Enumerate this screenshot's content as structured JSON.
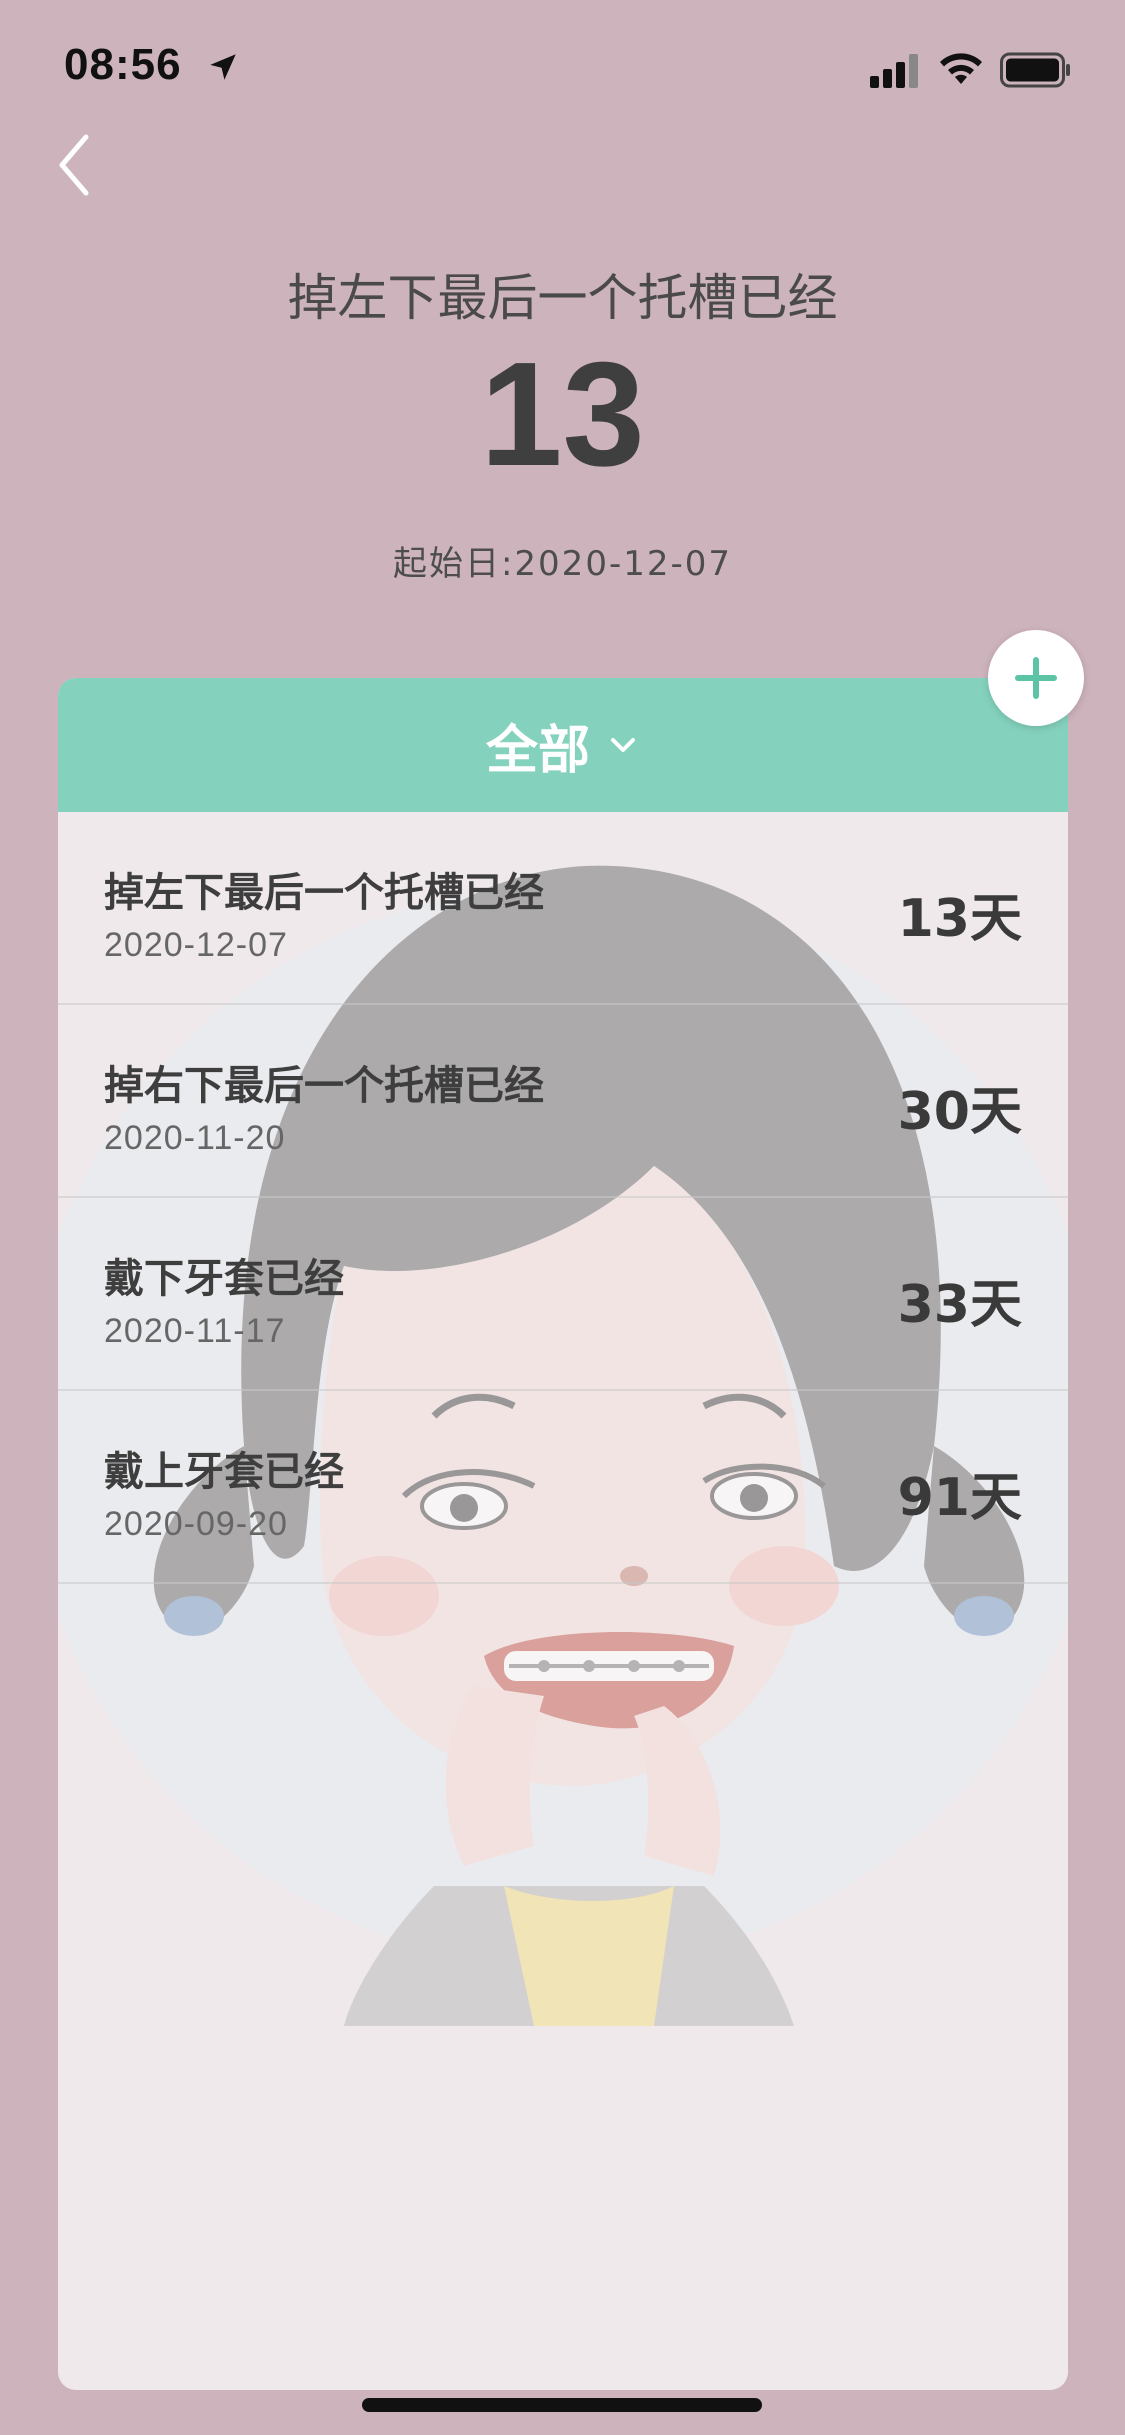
{
  "status_bar": {
    "time": "08:56"
  },
  "header": {
    "title": "掉左下最后一个托槽已经",
    "count": "13",
    "start_date": "起始日:2020-12-07"
  },
  "card": {
    "filter_label": "全部",
    "accent_color": "#84d2be"
  },
  "events": [
    {
      "title": "掉左下最后一个托槽已经",
      "date": "2020-12-07",
      "days": "13天"
    },
    {
      "title": "掉右下最后一个托槽已经",
      "date": "2020-11-20",
      "days": "30天"
    },
    {
      "title": "戴下牙套已经",
      "date": "2020-11-17",
      "days": "33天"
    },
    {
      "title": "戴上牙套已经",
      "date": "2020-09-20",
      "days": "91天"
    }
  ],
  "icons": {
    "back": "chevron-left-icon",
    "filter": "chevron-down-icon",
    "add": "plus-icon",
    "location": "location-arrow-icon",
    "signal": "cellular-signal-icon",
    "wifi": "wifi-icon",
    "battery": "battery-icon"
  }
}
